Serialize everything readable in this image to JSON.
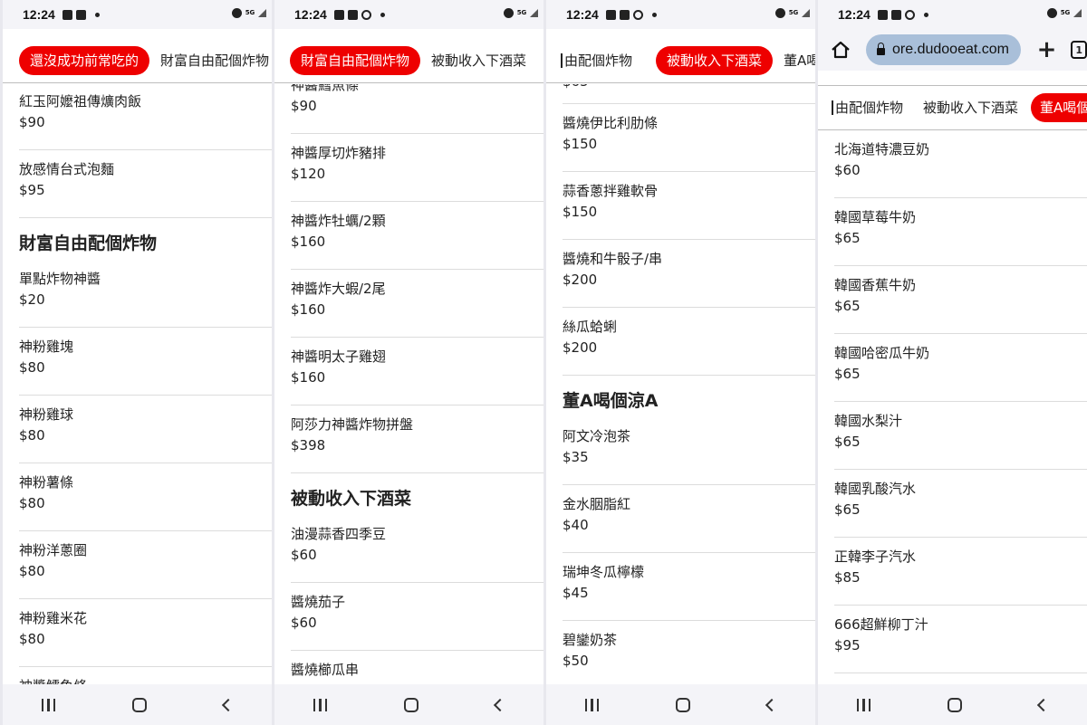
{
  "status": {
    "time": "12:24",
    "network_label": "5G"
  },
  "browser": {
    "url": "ore.dudooeat.com",
    "tabs_count": "1"
  },
  "panels": [
    {
      "tabs": [
        {
          "label": "還沒成功前常吃的",
          "active": true
        },
        {
          "label": "財富自由配個炸物",
          "active": false
        }
      ],
      "rows": [
        {
          "type": "item",
          "name": "紅玉阿嬤祖傳爌肉飯",
          "price": "$90"
        },
        {
          "type": "item",
          "name": "放感情台式泡麵",
          "price": "$95"
        },
        {
          "type": "section",
          "title": "財富自由配個炸物"
        },
        {
          "type": "item",
          "name": "單點炸物神醬",
          "price": "$20"
        },
        {
          "type": "item",
          "name": "神粉雞塊",
          "price": "$80"
        },
        {
          "type": "item",
          "name": "神粉雞球",
          "price": "$80"
        },
        {
          "type": "item",
          "name": "神粉薯條",
          "price": "$80"
        },
        {
          "type": "item",
          "name": "神粉洋蔥圈",
          "price": "$80"
        },
        {
          "type": "item",
          "name": "神粉雞米花",
          "price": "$80"
        },
        {
          "type": "item",
          "name": "神醬鱈魚條",
          "price": ""
        }
      ]
    },
    {
      "tabs": [
        {
          "label": "財富自由配個炸物",
          "active": true
        },
        {
          "label": "被動收入下酒菜",
          "active": false
        }
      ],
      "rows": [
        {
          "type": "item",
          "name": "神醬鱈魚條",
          "price": "$90"
        },
        {
          "type": "item",
          "name": "神醬厚切炸豬排",
          "price": "$120"
        },
        {
          "type": "item",
          "name": "神醬炸牡蠣/2顆",
          "price": "$160"
        },
        {
          "type": "item",
          "name": "神醬炸大蝦/2尾",
          "price": "$160"
        },
        {
          "type": "item",
          "name": "神醬明太子雞翅",
          "price": "$160"
        },
        {
          "type": "item",
          "name": "阿莎力神醬炸物拼盤",
          "price": "$398"
        },
        {
          "type": "section",
          "title": "被動收入下酒菜"
        },
        {
          "type": "item",
          "name": "油漫蒜香四季豆",
          "price": "$60"
        },
        {
          "type": "item",
          "name": "醬燒茄子",
          "price": "$60"
        },
        {
          "type": "item",
          "name": "醬燒櫛瓜串",
          "price": ""
        }
      ]
    },
    {
      "tabs": [
        {
          "label": "由配個炸物",
          "active": false
        },
        {
          "label": "被動收入下酒菜",
          "active": true
        },
        {
          "label": "董A喝個涼A",
          "active": false
        }
      ],
      "rows": [
        {
          "type": "item",
          "name": "醬燒伊比利肋條",
          "price": "$150"
        },
        {
          "type": "item",
          "name": "蒜香蔥拌雞軟骨",
          "price": "$150"
        },
        {
          "type": "item",
          "name": "醬燒和牛骰子/串",
          "price": "$200"
        },
        {
          "type": "item",
          "name": "絲瓜蛤蜊",
          "price": "$200"
        },
        {
          "type": "section",
          "title": "董A喝個涼A"
        },
        {
          "type": "item",
          "name": "阿文冷泡茶",
          "price": "$35"
        },
        {
          "type": "item",
          "name": "金水胭脂紅",
          "price": "$40"
        },
        {
          "type": "item",
          "name": "瑞坤冬瓜檸檬",
          "price": "$45"
        },
        {
          "type": "item",
          "name": "碧鑾奶茶",
          "price": "$50"
        }
      ]
    },
    {
      "tabs": [
        {
          "label": "由配個炸物",
          "active": false
        },
        {
          "label": "被動收入下酒菜",
          "active": false
        },
        {
          "label": "董A喝個",
          "active": true
        }
      ],
      "rows": [
        {
          "type": "item",
          "name": "北海道特濃豆奶",
          "price": "$60"
        },
        {
          "type": "item",
          "name": "韓國草莓牛奶",
          "price": "$65"
        },
        {
          "type": "item",
          "name": "韓國香蕉牛奶",
          "price": "$65"
        },
        {
          "type": "item",
          "name": "韓國哈密瓜牛奶",
          "price": "$65"
        },
        {
          "type": "item",
          "name": "韓國水梨汁",
          "price": "$65"
        },
        {
          "type": "item",
          "name": "韓國乳酸汽水",
          "price": "$65"
        },
        {
          "type": "item",
          "name": "正韓李子汽水",
          "price": "$85"
        },
        {
          "type": "item",
          "name": "666超鮮柳丁汁",
          "price": "$95"
        }
      ]
    }
  ]
}
